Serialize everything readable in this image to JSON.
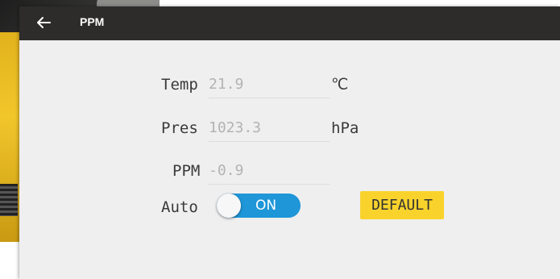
{
  "appbar": {
    "title": "PPM",
    "back_icon": "arrow-left-icon"
  },
  "form": {
    "temp": {
      "label": "Temp",
      "value": "21.9",
      "unit": "℃"
    },
    "pres": {
      "label": "Pres",
      "value": "1023.3",
      "unit": "hPa"
    },
    "ppm": {
      "label": "PPM",
      "value": "-0.9"
    },
    "auto": {
      "label": "Auto",
      "toggle_text": "ON",
      "checked": true
    }
  },
  "actions": {
    "default_label": "DEFAULT"
  },
  "colors": {
    "appbar": "#2d2c2a",
    "background": "#efefef",
    "toggle_on": "#1e96d8",
    "default_button": "#f9d32c"
  }
}
